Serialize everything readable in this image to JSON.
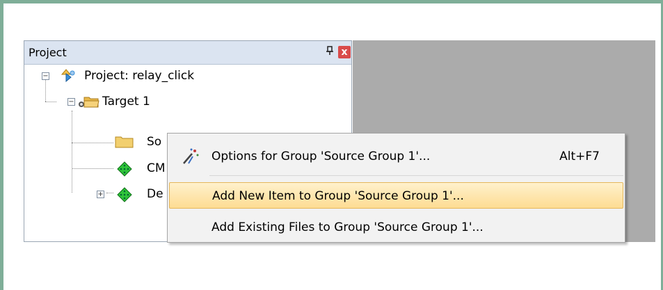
{
  "panel": {
    "title": "Project",
    "pin_glyph": "т",
    "close_glyph": "x"
  },
  "tree": {
    "root_expander": "−",
    "root_label": "Project: relay_click",
    "target_expander": "−",
    "target_label": "Target 1",
    "items": [
      {
        "label": "So",
        "icon": "folder-icon"
      },
      {
        "label": "CM",
        "icon": "green-diamond-icon"
      },
      {
        "label": "De",
        "icon": "green-diamond-icon",
        "expander": "+"
      }
    ]
  },
  "context_menu": {
    "items": [
      {
        "label": "Options for Group 'Source Group 1'...",
        "shortcut": "Alt+F7",
        "icon": "options-wand-icon"
      },
      {
        "label": "Add New  Item to Group 'Source Group 1'...",
        "highlighted": true
      },
      {
        "label": "Add Existing Files to Group 'Source Group 1'..."
      }
    ]
  },
  "colors": {
    "frame": "#7fae98",
    "panel_title_bg": "#dbe4f1",
    "close_button": "#d94b4b",
    "gray_area": "#ababab",
    "highlight": "#fddc93"
  }
}
